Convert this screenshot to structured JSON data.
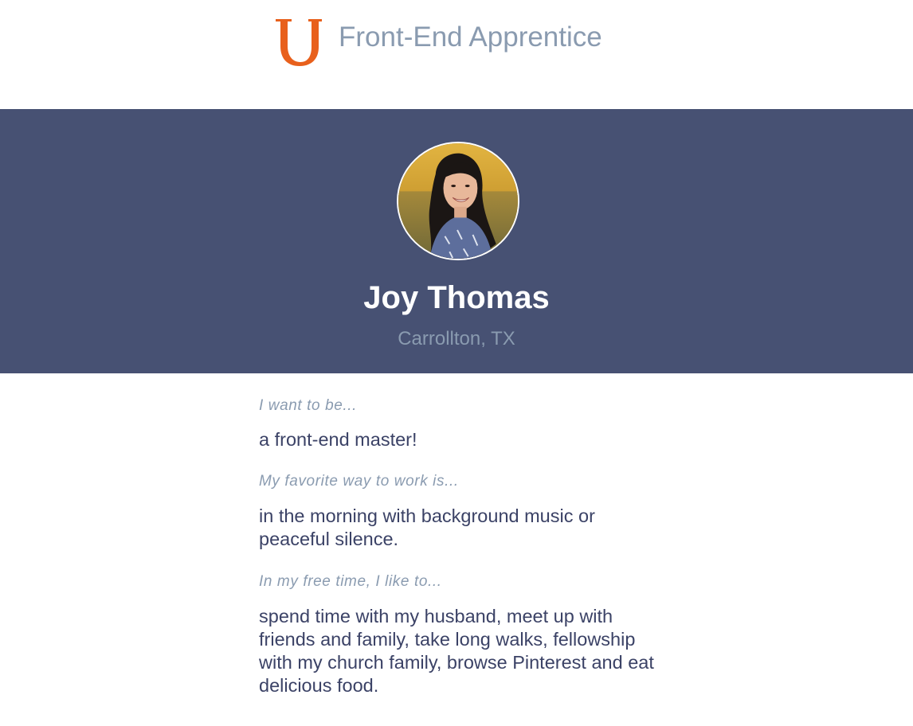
{
  "header": {
    "logo_icon": "u-logo-icon",
    "logo_color": "#e8601c",
    "title": "Front-End Apprentice"
  },
  "profile": {
    "avatar_icon": "profile-photo",
    "name": "Joy Thomas",
    "location": "Carrollton, TX",
    "banner_color": "#475173"
  },
  "qa": [
    {
      "question": "I want to be...",
      "answer": "a front-end master!"
    },
    {
      "question": "My favorite way to work is...",
      "answer": "in the morning with background music or peaceful silence."
    },
    {
      "question": "In my free time, I like to...",
      "answer": "spend time with my husband, meet up with friends and family, take long walks, fellowship with my church family, browse Pinterest and eat delicious food."
    }
  ]
}
